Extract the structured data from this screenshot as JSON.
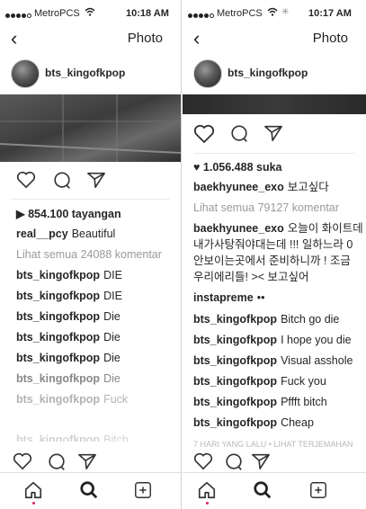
{
  "left": {
    "status": {
      "carrier": "MetroPCS",
      "time": "10:18 AM"
    },
    "nav": {
      "title": "Photo"
    },
    "post": {
      "username": "bts_kingofkpop"
    },
    "views": "854.100 tayangan",
    "caption": {
      "user": "real__pcy",
      "text": "Beautiful"
    },
    "view_all": "Lihat semua 24088 komentar",
    "comments": [
      {
        "user": "bts_kingofkpop",
        "text": "DIE"
      },
      {
        "user": "bts_kingofkpop",
        "text": "DIE"
      },
      {
        "user": "bts_kingofkpop",
        "text": "Die"
      },
      {
        "user": "bts_kingofkpop",
        "text": "Die"
      },
      {
        "user": "bts_kingofkpop",
        "text": "Die"
      },
      {
        "user": "bts_kingofkpop",
        "text": "Die"
      },
      {
        "user": "bts_kingofkpop",
        "text": "Fuck"
      },
      {
        "user": "bts_kingofkpop",
        "text": "Bitch"
      }
    ]
  },
  "right": {
    "status": {
      "carrier": "MetroPCS",
      "time": "10:17 AM"
    },
    "nav": {
      "title": "Photo"
    },
    "post": {
      "username": "bts_kingofkpop"
    },
    "likes": "1.056.488 suka",
    "caption": {
      "user": "baekhyunee_exo",
      "text": "보고싶다"
    },
    "view_all": "Lihat semua 79127 komentar",
    "long_comment": {
      "user": "baekhyunee_exo",
      "line1": "오늘이 화이트데",
      "line2": "내가사탕줘야대는데 !!! 일하느라 0",
      "line3": "안보이는곳에서 준비하니까 ! 조금",
      "line4": "우리에리들! >< 보고싶어"
    },
    "instapreme": {
      "user": "instapreme",
      "text": "••"
    },
    "comments": [
      {
        "user": "bts_kingofkpop",
        "text": "Bitch go die"
      },
      {
        "user": "bts_kingofkpop",
        "text": "I hope you die"
      },
      {
        "user": "bts_kingofkpop",
        "text": "Visual asshole"
      },
      {
        "user": "bts_kingofkpop",
        "text": "Fuck you"
      },
      {
        "user": "bts_kingofkpop",
        "text": "Pffft bitch"
      },
      {
        "user": "bts_kingofkpop",
        "text": "Cheap"
      }
    ],
    "footer": "7 HARI YANG LALU • LIHAT TERJEMAHAN"
  }
}
